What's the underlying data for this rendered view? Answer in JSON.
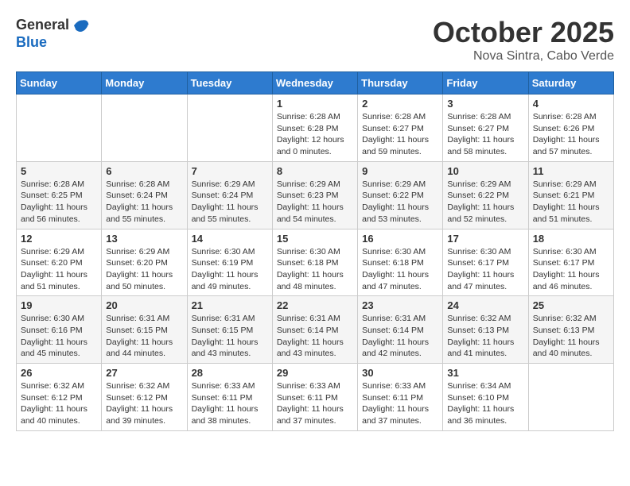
{
  "logo": {
    "general": "General",
    "blue": "Blue"
  },
  "title": "October 2025",
  "subtitle": "Nova Sintra, Cabo Verde",
  "days_of_week": [
    "Sunday",
    "Monday",
    "Tuesday",
    "Wednesday",
    "Thursday",
    "Friday",
    "Saturday"
  ],
  "weeks": [
    [
      {
        "day": "",
        "info": ""
      },
      {
        "day": "",
        "info": ""
      },
      {
        "day": "",
        "info": ""
      },
      {
        "day": "1",
        "info": "Sunrise: 6:28 AM\nSunset: 6:28 PM\nDaylight: 12 hours\nand 0 minutes."
      },
      {
        "day": "2",
        "info": "Sunrise: 6:28 AM\nSunset: 6:27 PM\nDaylight: 11 hours\nand 59 minutes."
      },
      {
        "day": "3",
        "info": "Sunrise: 6:28 AM\nSunset: 6:27 PM\nDaylight: 11 hours\nand 58 minutes."
      },
      {
        "day": "4",
        "info": "Sunrise: 6:28 AM\nSunset: 6:26 PM\nDaylight: 11 hours\nand 57 minutes."
      }
    ],
    [
      {
        "day": "5",
        "info": "Sunrise: 6:28 AM\nSunset: 6:25 PM\nDaylight: 11 hours\nand 56 minutes."
      },
      {
        "day": "6",
        "info": "Sunrise: 6:28 AM\nSunset: 6:24 PM\nDaylight: 11 hours\nand 55 minutes."
      },
      {
        "day": "7",
        "info": "Sunrise: 6:29 AM\nSunset: 6:24 PM\nDaylight: 11 hours\nand 55 minutes."
      },
      {
        "day": "8",
        "info": "Sunrise: 6:29 AM\nSunset: 6:23 PM\nDaylight: 11 hours\nand 54 minutes."
      },
      {
        "day": "9",
        "info": "Sunrise: 6:29 AM\nSunset: 6:22 PM\nDaylight: 11 hours\nand 53 minutes."
      },
      {
        "day": "10",
        "info": "Sunrise: 6:29 AM\nSunset: 6:22 PM\nDaylight: 11 hours\nand 52 minutes."
      },
      {
        "day": "11",
        "info": "Sunrise: 6:29 AM\nSunset: 6:21 PM\nDaylight: 11 hours\nand 51 minutes."
      }
    ],
    [
      {
        "day": "12",
        "info": "Sunrise: 6:29 AM\nSunset: 6:20 PM\nDaylight: 11 hours\nand 51 minutes."
      },
      {
        "day": "13",
        "info": "Sunrise: 6:29 AM\nSunset: 6:20 PM\nDaylight: 11 hours\nand 50 minutes."
      },
      {
        "day": "14",
        "info": "Sunrise: 6:30 AM\nSunset: 6:19 PM\nDaylight: 11 hours\nand 49 minutes."
      },
      {
        "day": "15",
        "info": "Sunrise: 6:30 AM\nSunset: 6:18 PM\nDaylight: 11 hours\nand 48 minutes."
      },
      {
        "day": "16",
        "info": "Sunrise: 6:30 AM\nSunset: 6:18 PM\nDaylight: 11 hours\nand 47 minutes."
      },
      {
        "day": "17",
        "info": "Sunrise: 6:30 AM\nSunset: 6:17 PM\nDaylight: 11 hours\nand 47 minutes."
      },
      {
        "day": "18",
        "info": "Sunrise: 6:30 AM\nSunset: 6:17 PM\nDaylight: 11 hours\nand 46 minutes."
      }
    ],
    [
      {
        "day": "19",
        "info": "Sunrise: 6:30 AM\nSunset: 6:16 PM\nDaylight: 11 hours\nand 45 minutes."
      },
      {
        "day": "20",
        "info": "Sunrise: 6:31 AM\nSunset: 6:15 PM\nDaylight: 11 hours\nand 44 minutes."
      },
      {
        "day": "21",
        "info": "Sunrise: 6:31 AM\nSunset: 6:15 PM\nDaylight: 11 hours\nand 43 minutes."
      },
      {
        "day": "22",
        "info": "Sunrise: 6:31 AM\nSunset: 6:14 PM\nDaylight: 11 hours\nand 43 minutes."
      },
      {
        "day": "23",
        "info": "Sunrise: 6:31 AM\nSunset: 6:14 PM\nDaylight: 11 hours\nand 42 minutes."
      },
      {
        "day": "24",
        "info": "Sunrise: 6:32 AM\nSunset: 6:13 PM\nDaylight: 11 hours\nand 41 minutes."
      },
      {
        "day": "25",
        "info": "Sunrise: 6:32 AM\nSunset: 6:13 PM\nDaylight: 11 hours\nand 40 minutes."
      }
    ],
    [
      {
        "day": "26",
        "info": "Sunrise: 6:32 AM\nSunset: 6:12 PM\nDaylight: 11 hours\nand 40 minutes."
      },
      {
        "day": "27",
        "info": "Sunrise: 6:32 AM\nSunset: 6:12 PM\nDaylight: 11 hours\nand 39 minutes."
      },
      {
        "day": "28",
        "info": "Sunrise: 6:33 AM\nSunset: 6:11 PM\nDaylight: 11 hours\nand 38 minutes."
      },
      {
        "day": "29",
        "info": "Sunrise: 6:33 AM\nSunset: 6:11 PM\nDaylight: 11 hours\nand 37 minutes."
      },
      {
        "day": "30",
        "info": "Sunrise: 6:33 AM\nSunset: 6:11 PM\nDaylight: 11 hours\nand 37 minutes."
      },
      {
        "day": "31",
        "info": "Sunrise: 6:34 AM\nSunset: 6:10 PM\nDaylight: 11 hours\nand 36 minutes."
      },
      {
        "day": "",
        "info": ""
      }
    ]
  ]
}
